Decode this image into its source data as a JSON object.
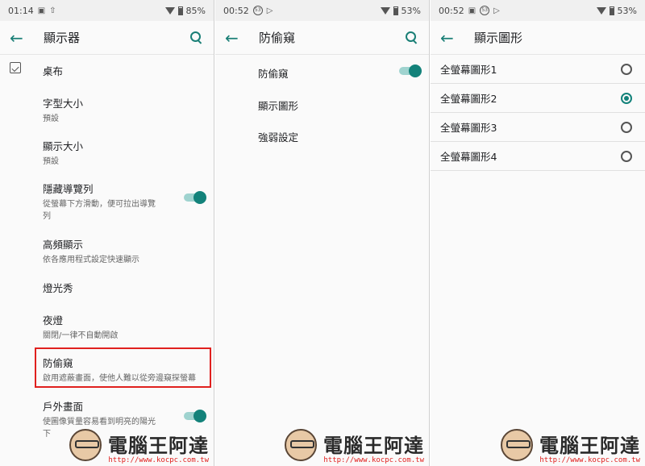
{
  "panels": [
    {
      "status": {
        "time": "01:14",
        "battery": "85%"
      },
      "title": "顯示器",
      "items": [
        {
          "title": "桌布"
        },
        {
          "title": "字型大小",
          "sub": "預設"
        },
        {
          "title": "顯示大小",
          "sub": "預設"
        },
        {
          "title": "隱藏導覽列",
          "sub": "從螢幕下方滑動，便可拉出導覽",
          "sub2": "列",
          "toggle": true
        },
        {
          "title": "高頻顯示",
          "sub": "依各應用程式設定快速顯示"
        },
        {
          "title": "燈光秀"
        },
        {
          "title": "夜燈",
          "sub": "關閉/一律不自動開啟"
        },
        {
          "title": "防偷窺",
          "sub": "啟用遮蔽畫面，使他人難以從旁邊窺探螢幕"
        },
        {
          "title": "戶外畫面",
          "sub": "使圖像質量容易看到明亮的陽光",
          "sub2": "下",
          "toggle": true
        }
      ]
    },
    {
      "status": {
        "time": "00:52",
        "badge": "53",
        "battery": "53%"
      },
      "title": "防偷窺",
      "items": [
        {
          "title": "防偷窺",
          "toggle": true
        },
        {
          "title": "顯示圖形"
        },
        {
          "title": "強弱設定"
        }
      ]
    },
    {
      "status": {
        "time": "00:52",
        "badge": "53",
        "battery": "53%"
      },
      "title": "顯示圖形",
      "options": [
        {
          "label": "全螢幕圖形1",
          "selected": false
        },
        {
          "label": "全螢幕圖形2",
          "selected": true
        },
        {
          "label": "全螢幕圖形3",
          "selected": false
        },
        {
          "label": "全螢幕圖形4",
          "selected": false
        }
      ]
    }
  ],
  "watermark": {
    "text": "電腦王阿達",
    "url": "http://www.kocpc.com.tw"
  },
  "colors": {
    "accent": "#13827a",
    "highlight": "#e0201e"
  }
}
